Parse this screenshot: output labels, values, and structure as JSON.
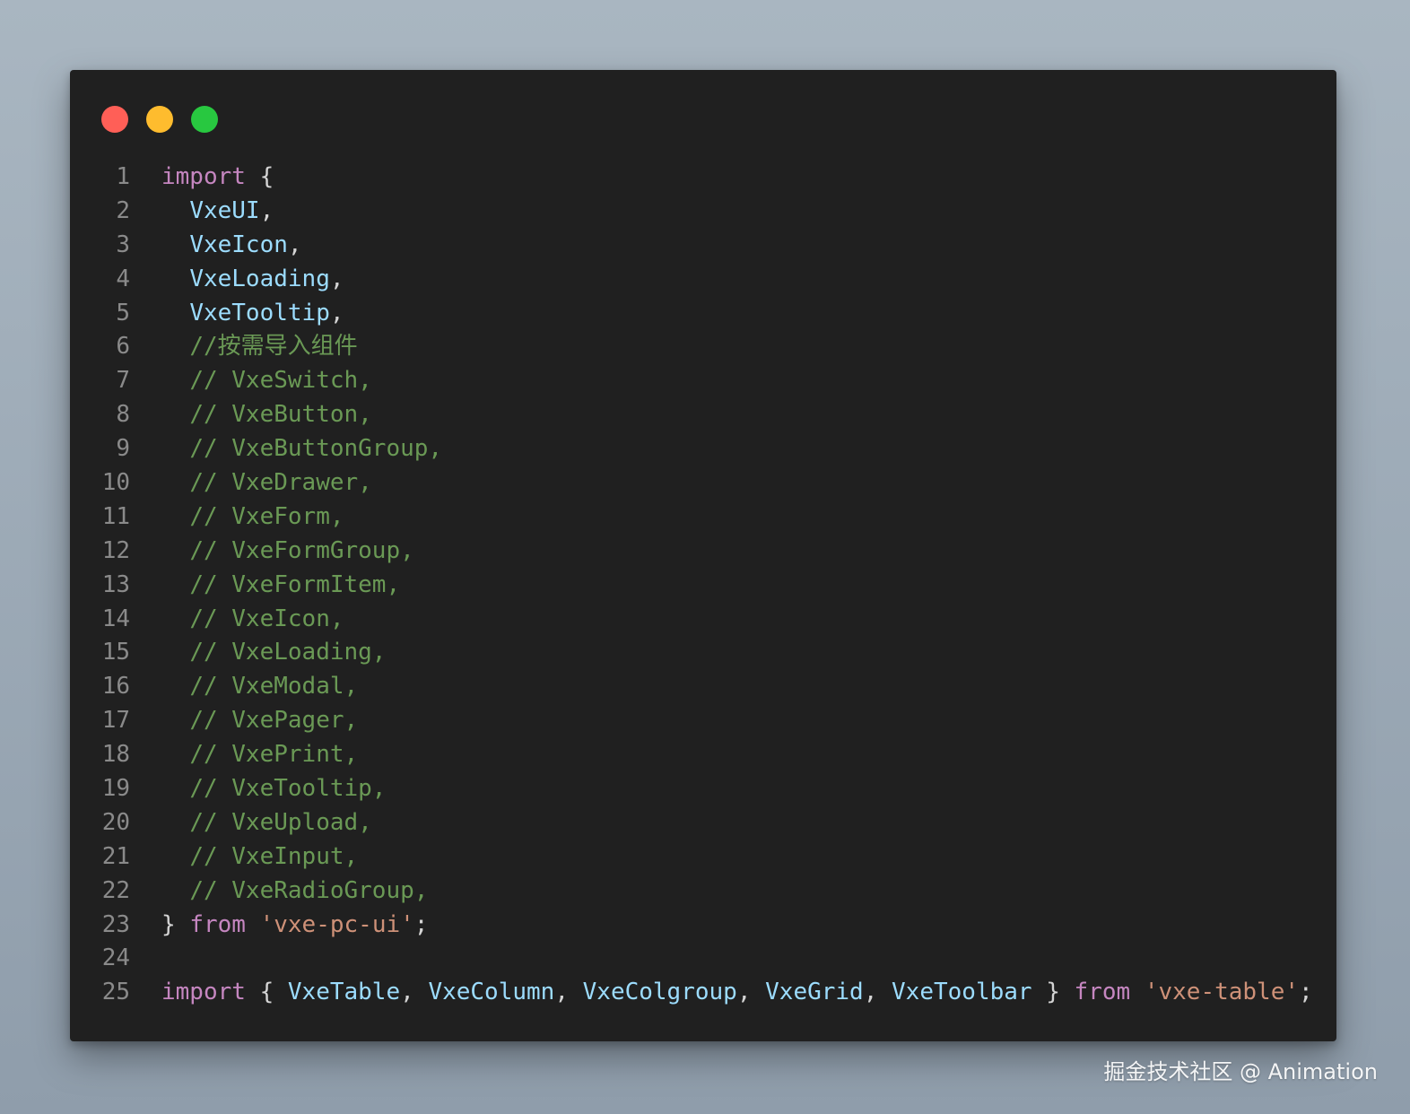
{
  "theme": {
    "keyword": "#c586c0",
    "identifier": "#9cdcfe",
    "comment": "#6a9955",
    "string": "#ce9178",
    "punct": "#d4d4d4",
    "line_number": "#8a8a8a"
  },
  "window_controls": {
    "close": {
      "icon": "close-dot-icon",
      "color": "#ff5f57"
    },
    "minimize": {
      "icon": "minimize-dot-icon",
      "color": "#febc2e"
    },
    "maximize": {
      "icon": "maximize-dot-icon",
      "color": "#28c840"
    }
  },
  "lines": [
    {
      "number": "1",
      "tokens": [
        [
          "keyword",
          "import"
        ],
        [
          "punct",
          " {"
        ]
      ]
    },
    {
      "number": "2",
      "tokens": [
        [
          "punct",
          "  "
        ],
        [
          "identifier",
          "VxeUI"
        ],
        [
          "punct",
          ","
        ]
      ]
    },
    {
      "number": "3",
      "tokens": [
        [
          "punct",
          "  "
        ],
        [
          "identifier",
          "VxeIcon"
        ],
        [
          "punct",
          ","
        ]
      ]
    },
    {
      "number": "4",
      "tokens": [
        [
          "punct",
          "  "
        ],
        [
          "identifier",
          "VxeLoading"
        ],
        [
          "punct",
          ","
        ]
      ]
    },
    {
      "number": "5",
      "tokens": [
        [
          "punct",
          "  "
        ],
        [
          "identifier",
          "VxeTooltip"
        ],
        [
          "punct",
          ","
        ]
      ]
    },
    {
      "number": "6",
      "tokens": [
        [
          "punct",
          "  "
        ],
        [
          "comment",
          "//按需导入组件"
        ]
      ]
    },
    {
      "number": "7",
      "tokens": [
        [
          "punct",
          "  "
        ],
        [
          "comment",
          "// VxeSwitch,"
        ]
      ]
    },
    {
      "number": "8",
      "tokens": [
        [
          "punct",
          "  "
        ],
        [
          "comment",
          "// VxeButton,"
        ]
      ]
    },
    {
      "number": "9",
      "tokens": [
        [
          "punct",
          "  "
        ],
        [
          "comment",
          "// VxeButtonGroup,"
        ]
      ]
    },
    {
      "number": "10",
      "tokens": [
        [
          "punct",
          "  "
        ],
        [
          "comment",
          "// VxeDrawer,"
        ]
      ]
    },
    {
      "number": "11",
      "tokens": [
        [
          "punct",
          "  "
        ],
        [
          "comment",
          "// VxeForm,"
        ]
      ]
    },
    {
      "number": "12",
      "tokens": [
        [
          "punct",
          "  "
        ],
        [
          "comment",
          "// VxeFormGroup,"
        ]
      ]
    },
    {
      "number": "13",
      "tokens": [
        [
          "punct",
          "  "
        ],
        [
          "comment",
          "// VxeFormItem,"
        ]
      ]
    },
    {
      "number": "14",
      "tokens": [
        [
          "punct",
          "  "
        ],
        [
          "comment",
          "// VxeIcon,"
        ]
      ]
    },
    {
      "number": "15",
      "tokens": [
        [
          "punct",
          "  "
        ],
        [
          "comment",
          "// VxeLoading,"
        ]
      ]
    },
    {
      "number": "16",
      "tokens": [
        [
          "punct",
          "  "
        ],
        [
          "comment",
          "// VxeModal,"
        ]
      ]
    },
    {
      "number": "17",
      "tokens": [
        [
          "punct",
          "  "
        ],
        [
          "comment",
          "// VxePager,"
        ]
      ]
    },
    {
      "number": "18",
      "tokens": [
        [
          "punct",
          "  "
        ],
        [
          "comment",
          "// VxePrint,"
        ]
      ]
    },
    {
      "number": "19",
      "tokens": [
        [
          "punct",
          "  "
        ],
        [
          "comment",
          "// VxeTooltip,"
        ]
      ]
    },
    {
      "number": "20",
      "tokens": [
        [
          "punct",
          "  "
        ],
        [
          "comment",
          "// VxeUpload,"
        ]
      ]
    },
    {
      "number": "21",
      "tokens": [
        [
          "punct",
          "  "
        ],
        [
          "comment",
          "// VxeInput,"
        ]
      ]
    },
    {
      "number": "22",
      "tokens": [
        [
          "punct",
          "  "
        ],
        [
          "comment",
          "// VxeRadioGroup,"
        ]
      ]
    },
    {
      "number": "23",
      "tokens": [
        [
          "punct",
          "} "
        ],
        [
          "keyword",
          "from"
        ],
        [
          "punct",
          " "
        ],
        [
          "string",
          "'vxe-pc-ui'"
        ],
        [
          "punct",
          ";"
        ]
      ]
    },
    {
      "number": "24",
      "tokens": []
    },
    {
      "number": "25",
      "tokens": [
        [
          "keyword",
          "import"
        ],
        [
          "punct",
          " { "
        ],
        [
          "identifier",
          "VxeTable"
        ],
        [
          "punct",
          ", "
        ],
        [
          "identifier",
          "VxeColumn"
        ],
        [
          "punct",
          ", "
        ],
        [
          "identifier",
          "VxeColgroup"
        ],
        [
          "punct",
          ", "
        ],
        [
          "identifier",
          "VxeGrid"
        ],
        [
          "punct",
          ", "
        ],
        [
          "identifier",
          "VxeToolbar"
        ],
        [
          "punct",
          " } "
        ],
        [
          "keyword",
          "from"
        ],
        [
          "punct",
          " "
        ],
        [
          "string",
          "'vxe-table'"
        ],
        [
          "punct",
          ";"
        ]
      ]
    }
  ],
  "watermark": "掘金技术社区 @ Animation"
}
